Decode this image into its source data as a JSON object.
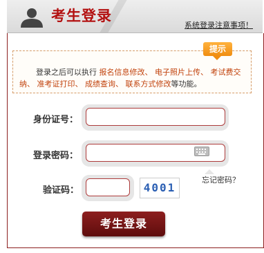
{
  "header": {
    "title": "考生登录",
    "notice_link": "系统登录注意事项！"
  },
  "tip": {
    "badge": "提示",
    "text_intro": "登录之后可以执行",
    "features": [
      "报名信息修改、",
      "电子照片上传、",
      "考试费交纳、",
      "准考证打印、",
      "成绩查询、",
      "联系方式修改"
    ],
    "text_end": "等功能。"
  },
  "form": {
    "id_label": "身份证号：",
    "password_label": "登录密码：",
    "captcha_label": "验证码：",
    "id_value": "",
    "password_value": "",
    "captcha_value": "",
    "captcha_image_text": "4001",
    "forgot_password": "忘记密码？"
  },
  "actions": {
    "login_button": "考生登录"
  },
  "colors": {
    "brand_red": "#b31111",
    "border_red": "#ad3b3b",
    "button_dark_red": "#7a1414",
    "tip_orange": "#f08d10",
    "highlight_orange": "#c1420c"
  }
}
